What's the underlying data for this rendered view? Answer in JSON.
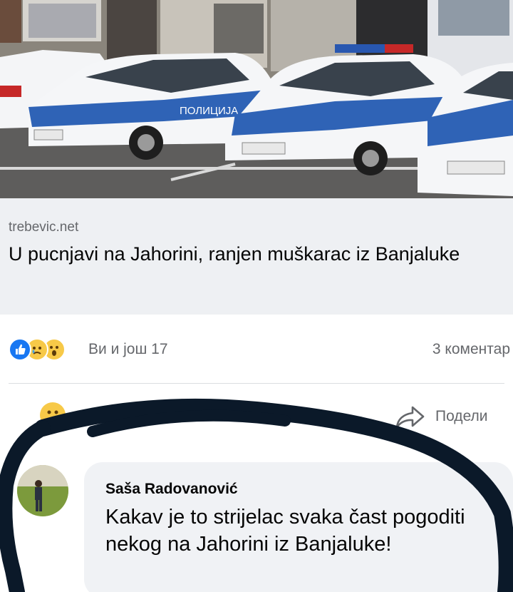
{
  "post": {
    "photo_icon": "police-cars-photo",
    "car_label": "ПОЛИЦИЈА",
    "link_preview": {
      "domain": "trebevic.net",
      "headline": "U pucnjavi na Jahorini, ranjen muškarac iz Banjaluke"
    },
    "reactions": {
      "icons": [
        "like-icon",
        "sad-icon",
        "wow-icon"
      ],
      "summary": "Ви и још 17",
      "comments": "3 коментар"
    },
    "actions": {
      "share_label": "Подели",
      "share_icon": "share-arrow-icon"
    }
  },
  "comment": {
    "author": "Saša Radovanović",
    "text": "Kakav je to strijelac svaka čast pogoditi nekog na Jahorini iz Banjaluke!"
  },
  "colors": {
    "brand_blue": "#1877f2",
    "police_blue": "#2f63b6",
    "marker": "#0b1929",
    "bubble": "#f0f2f5"
  }
}
